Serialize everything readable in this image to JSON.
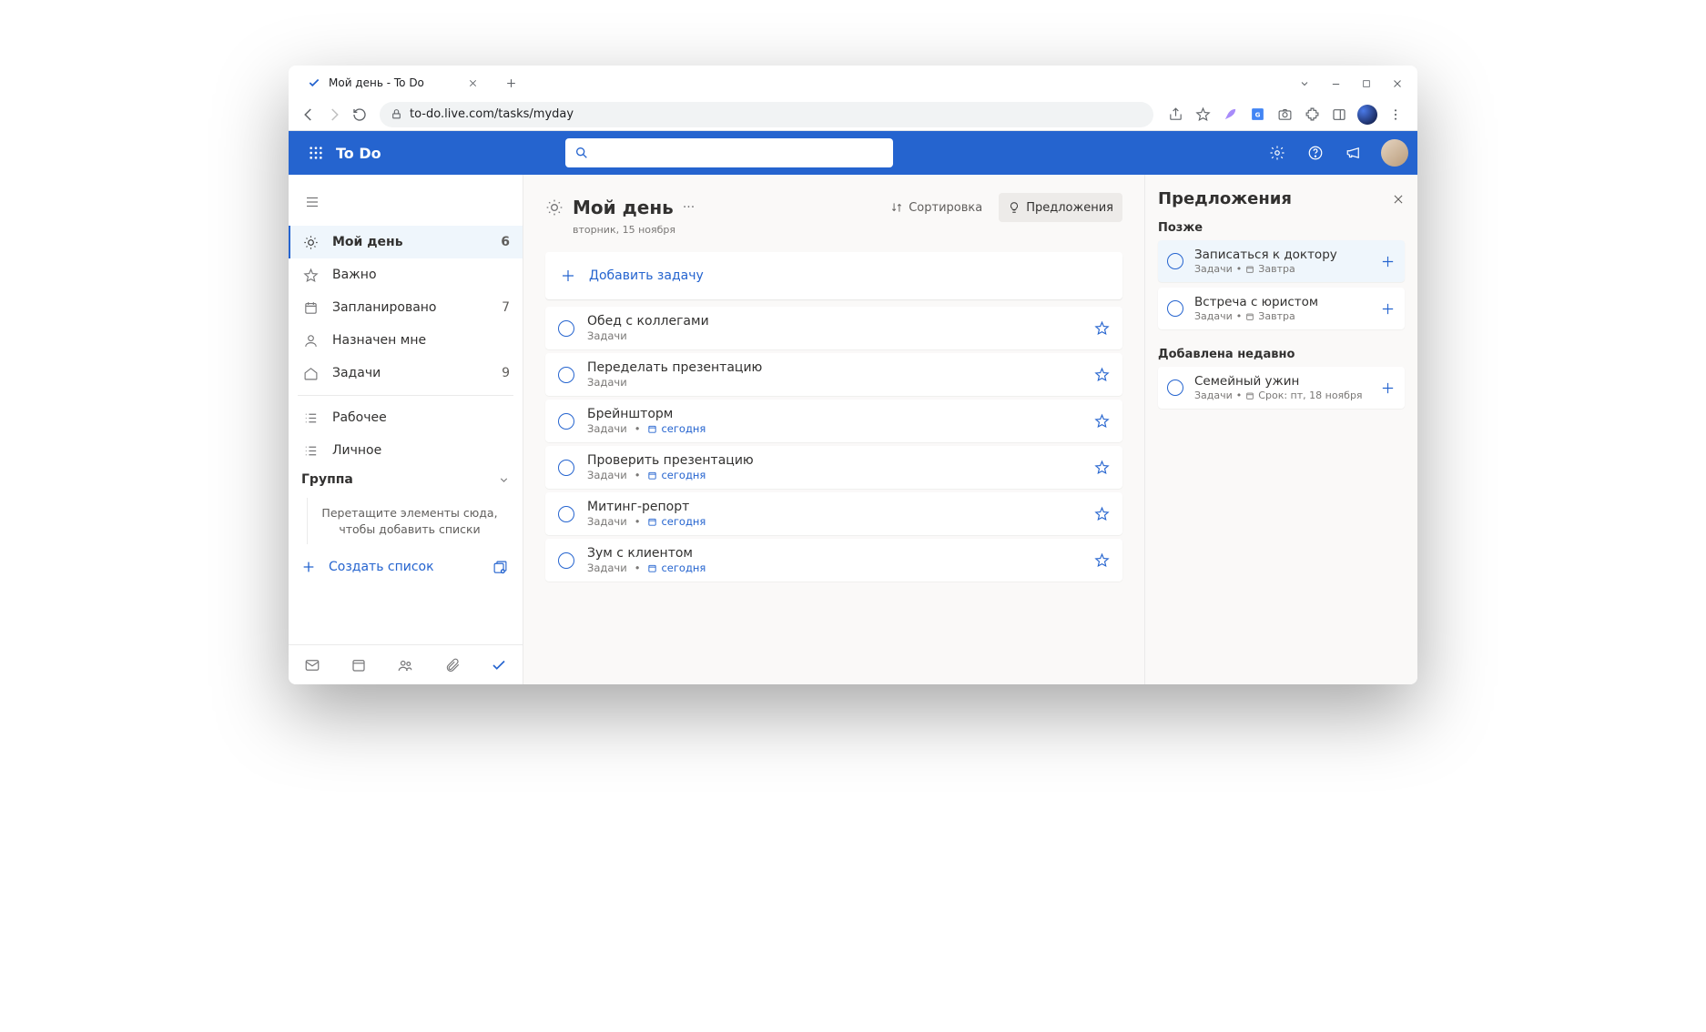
{
  "browser": {
    "tab_title": "Мой день - To Do",
    "url": "to-do.live.com/tasks/myday"
  },
  "header": {
    "app_name": "To Do"
  },
  "sidebar": {
    "items": [
      {
        "label": "Мой день",
        "count": "6"
      },
      {
        "label": "Важно",
        "count": ""
      },
      {
        "label": "Запланировано",
        "count": "7"
      },
      {
        "label": "Назначен мне",
        "count": ""
      },
      {
        "label": "Задачи",
        "count": "9"
      }
    ],
    "lists": [
      {
        "label": "Рабочее"
      },
      {
        "label": "Личное"
      }
    ],
    "group_label": "Группа",
    "drop_hint": "Перетащите элементы сюда, чтобы добавить списки",
    "new_list_label": "Создать список"
  },
  "main": {
    "title": "Мой день",
    "date": "вторник, 15 ноября",
    "sort_label": "Сортировка",
    "suggestions_label": "Предложения",
    "add_task_placeholder": "Добавить задачу",
    "tasks": [
      {
        "title": "Обед с коллегами",
        "list": "Задачи",
        "due": ""
      },
      {
        "title": "Переделать презентацию",
        "list": "Задачи",
        "due": ""
      },
      {
        "title": "Брейншторм",
        "list": "Задачи",
        "due": "сегодня"
      },
      {
        "title": "Проверить презентацию",
        "list": "Задачи",
        "due": "сегодня"
      },
      {
        "title": "Митинг-репорт",
        "list": "Задачи",
        "due": "сегодня"
      },
      {
        "title": "Зум с клиентом",
        "list": "Задачи",
        "due": "сегодня"
      }
    ]
  },
  "panel": {
    "title": "Предложения",
    "sections": {
      "later": "Позже",
      "recent": "Добавлена недавно"
    },
    "later_items": [
      {
        "title": "Записаться к доктору",
        "list": "Задачи",
        "due": "Завтра"
      },
      {
        "title": "Встреча с юристом",
        "list": "Задачи",
        "due": "Завтра"
      }
    ],
    "recent_items": [
      {
        "title": "Семейный ужин",
        "list": "Задачи",
        "due": "Срок: пт, 18 ноября"
      }
    ]
  }
}
